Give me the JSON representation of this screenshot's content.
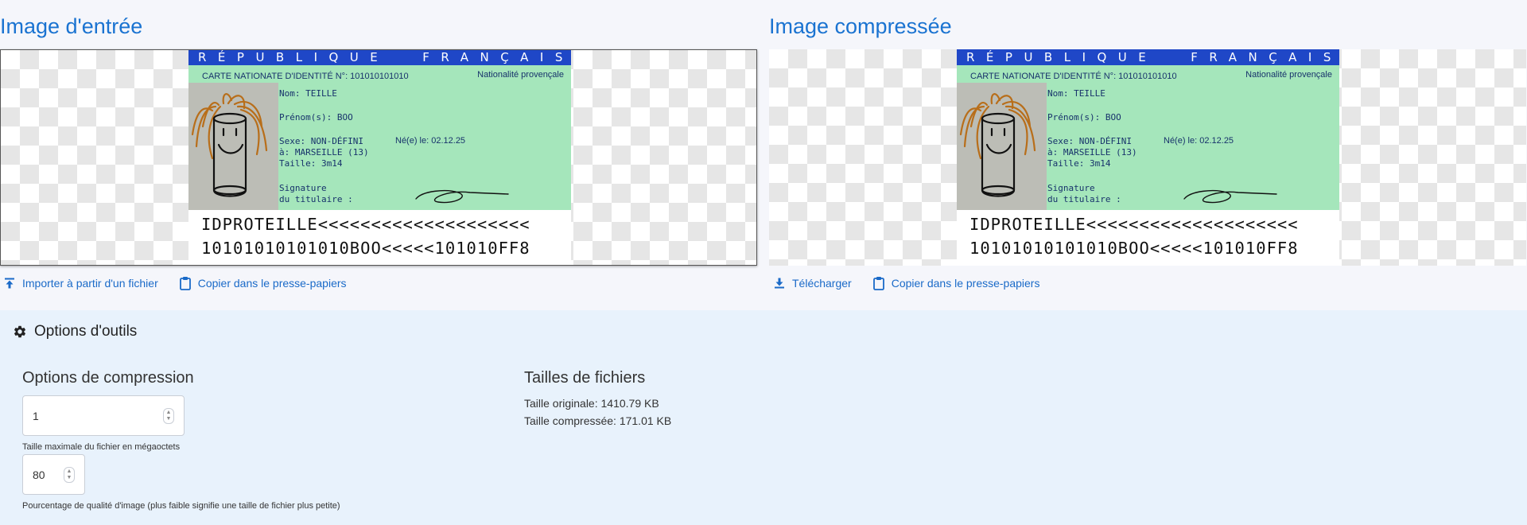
{
  "input_panel": {
    "title": "Image d'entrée",
    "actions": {
      "import_label": "Importer à partir d'un fichier",
      "copy_label": "Copier dans le presse-papiers"
    }
  },
  "output_panel": {
    "title": "Image compressée",
    "actions": {
      "download_label": "Télécharger",
      "copy_label": "Copier dans le presse-papiers"
    }
  },
  "id_card": {
    "band_word_1": "RÉPUBLIQUE",
    "band_word_2": "FRANÇAISE",
    "header": "CARTE NATIONATE D'IDENTITÉ N°: 101010101010",
    "nationality": "Nationalité provençale",
    "nom": "Nom: TEILLE",
    "prenoms": "Prénom(s): BOO",
    "sexe": "Sexe: NON-DÉFINI",
    "ne_le": "Né(e) le: 02.12.25",
    "lieu": "à: MARSEILLE (13)",
    "taille": "Taille: 3m14",
    "signature_line1": "Signature",
    "signature_line2": "du titulaire :",
    "mrz_line1": "IDPROTEILLE<<<<<<<<<<<<<<<<<<<<",
    "mrz_line2": "10101010101010BOO<<<<<101010FF8",
    "colors": {
      "band": "#1f47c7",
      "green": "#a5e6bb",
      "photo_bg": "#bcbdb6"
    }
  },
  "options": {
    "title": "Options d'outils",
    "compression": {
      "title": "Options de compression",
      "max_size_value": "1",
      "max_size_helper": "Taille maximale du fichier en mégaoctets",
      "quality_value": "80",
      "quality_helper": "Pourcentage de qualité d'image (plus faible signifie une taille de fichier plus petite)"
    },
    "file_sizes": {
      "title": "Tailles de fichiers",
      "original": "Taille originale: 1410.79 KB",
      "compressed": "Taille compressée: 171.01 KB"
    }
  },
  "theme": {
    "accent": "#1a73d1",
    "options_bg": "#e8f2fc",
    "page_bg": "#f5f6fb"
  }
}
